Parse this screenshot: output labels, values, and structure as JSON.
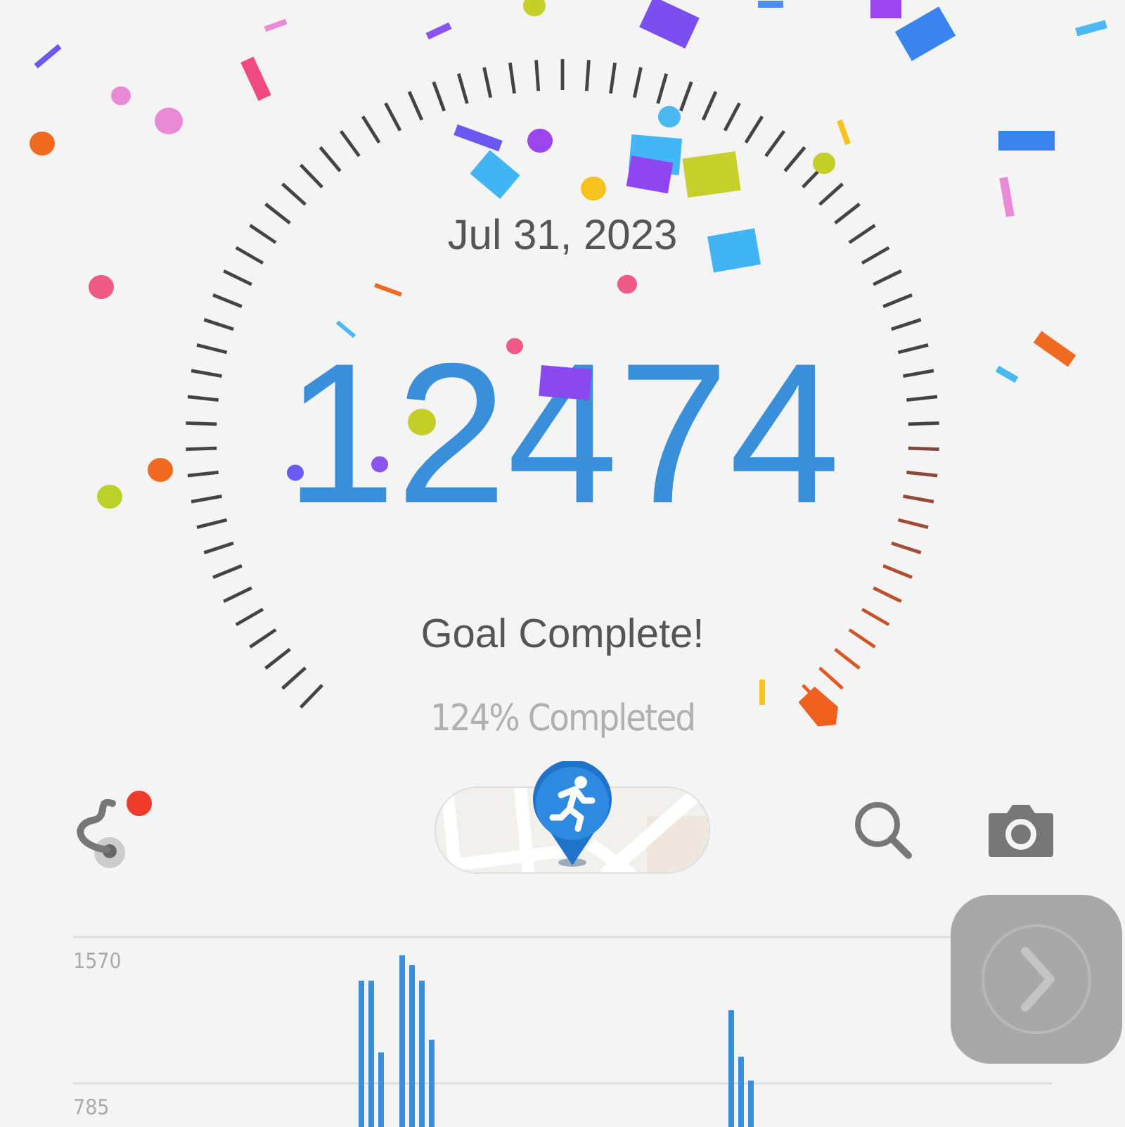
{
  "gauge": {
    "date": "Jul 31, 2023",
    "steps": "12474",
    "status": "Goal Complete!",
    "completion": "124% Completed"
  },
  "toolbar": {
    "route_badge": true
  },
  "chart": {
    "y_labels": [
      "1570",
      "785"
    ]
  }
}
